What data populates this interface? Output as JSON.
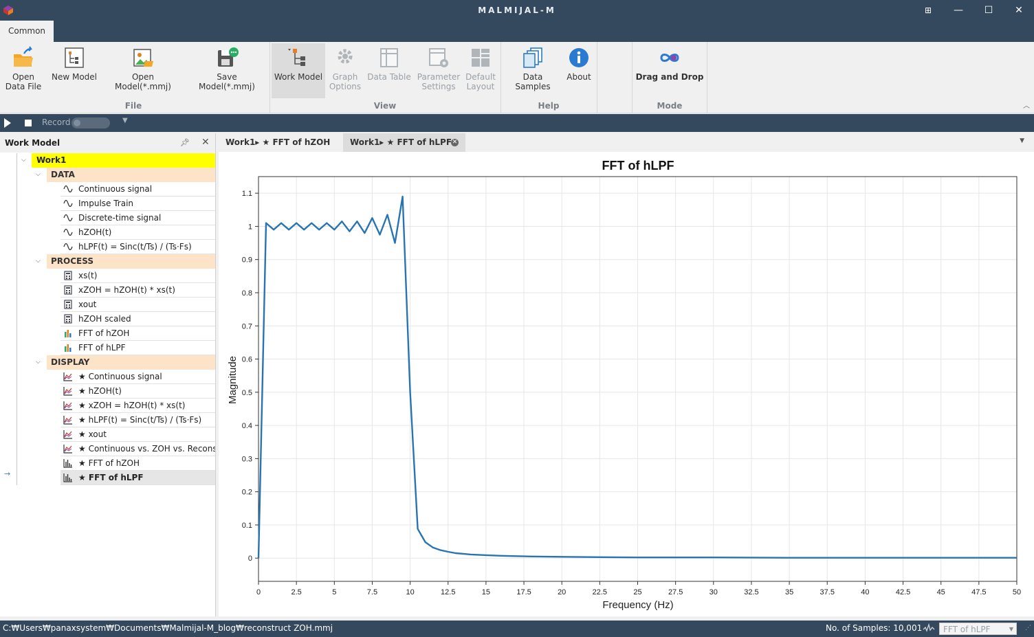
{
  "app": {
    "title": "MALMIJAL-M"
  },
  "window_controls": {
    "pin": "⊞",
    "minimize": "—",
    "maximize": "☐",
    "close": "✕"
  },
  "ribbon": {
    "tab": "Common",
    "groups": {
      "file": "File",
      "view": "View",
      "help": "Help",
      "mode": "Mode"
    },
    "buttons": {
      "open_data_file": "Open Data File",
      "new_model": "New Model",
      "open_model": "Open Model(*.mmj)",
      "save_model": "Save Model(*.mmj)",
      "work_model": "Work Model",
      "graph_options": "Graph Options",
      "data_table": "Data Table",
      "parameter_settings": "Parameter Settings",
      "default_layout": "Default Layout",
      "data_samples": "Data Samples",
      "about": "About",
      "drag_and_drop": "Drag and Drop"
    }
  },
  "recordbar": {
    "record_label": "Record"
  },
  "work_model": {
    "title": "Work Model",
    "root": "Work1",
    "groups": [
      {
        "label": "DATA",
        "items": [
          "Continuous signal",
          "Impulse Train",
          "Discrete-time signal",
          "hZOH(t)",
          "hLPF(t) = Sinc(t/Ts) / (Ts·Fs)"
        ]
      },
      {
        "label": "PROCESS",
        "items": [
          "xs(t)",
          "xZOH = hZOH(t) * xs(t)",
          "xout",
          "hZOH scaled",
          "FFT of hZOH",
          "FFT of hLPF"
        ]
      },
      {
        "label": "DISPLAY",
        "items": [
          "★ Continuous signal",
          "★ hZOH(t)",
          "★ xZOH = hZOH(t) * xs(t)",
          "★ hLPF(t) = Sinc(t/Ts) / (Ts·Fs)",
          "★ xout",
          "★ Continuous vs. ZOH vs. Reconstructed",
          "★ FFT of hZOH",
          "★ FFT of hLPF"
        ]
      }
    ]
  },
  "doc_tabs": [
    "Work1▸ ★ FFT of hZOH",
    "Work1▸ ★ FFT of hLPF"
  ],
  "chart_data": {
    "type": "line",
    "title": "FFT of hLPF",
    "xlabel": "Frequency (Hz)",
    "ylabel": "Magnitude",
    "xlim": [
      0,
      50
    ],
    "ylim": [
      -0.07,
      1.15
    ],
    "xticks": [
      0,
      2.5,
      5,
      7.5,
      10,
      12.5,
      15,
      17.5,
      20,
      22.5,
      25,
      27.5,
      30,
      32.5,
      35,
      37.5,
      40,
      42.5,
      45,
      47.5,
      50
    ],
    "xtick_labels": [
      "0",
      "2.5",
      "5",
      "7.5",
      "10",
      "12.5",
      "15",
      "17.5",
      "20",
      "22.5",
      "25",
      "27.5",
      "30",
      "32.5",
      "35",
      "37.5",
      "40",
      "42.5",
      "45",
      "47.5",
      "50"
    ],
    "yticks": [
      0,
      0.1,
      0.2,
      0.3,
      0.4,
      0.5,
      0.6,
      0.7,
      0.8,
      0.9,
      1,
      1.1
    ],
    "ytick_labels": [
      "0",
      "0.1",
      "0.2",
      "0.3",
      "0.4",
      "0.5",
      "0.6",
      "0.7",
      "0.8",
      "0.9",
      "1",
      "1.1"
    ],
    "grid": true,
    "color": "#2874b2",
    "x": [
      0,
      0.5,
      1,
      1.5,
      2,
      2.5,
      3,
      3.5,
      4,
      4.5,
      5,
      5.5,
      6,
      6.5,
      7,
      7.5,
      8,
      8.5,
      9,
      9.5,
      10,
      10.5,
      11,
      11.5,
      12,
      12.5,
      13,
      13.5,
      14,
      15,
      16,
      17,
      18,
      20,
      22.5,
      25,
      30,
      35,
      40,
      45,
      50
    ],
    "y": [
      0,
      1.01,
      0.99,
      1.01,
      0.99,
      1.01,
      0.99,
      1.01,
      0.99,
      1.01,
      0.99,
      1.015,
      0.985,
      1.015,
      0.98,
      1.025,
      0.975,
      1.035,
      0.95,
      1.09,
      0.5,
      0.088,
      0.048,
      0.032,
      0.024,
      0.019,
      0.015,
      0.013,
      0.011,
      0.009,
      0.007,
      0.006,
      0.005,
      0.004,
      0.003,
      0.002,
      0.002,
      0.001,
      0.001,
      0.001,
      0.001
    ]
  },
  "status": {
    "path": "C:₩Users₩panaxsystem₩Documents₩Malmijal-M_blog₩reconstruct ZOH.mmj",
    "samples": "No. of Samples: 10,001",
    "selected_view": "FFT of hLPF"
  }
}
